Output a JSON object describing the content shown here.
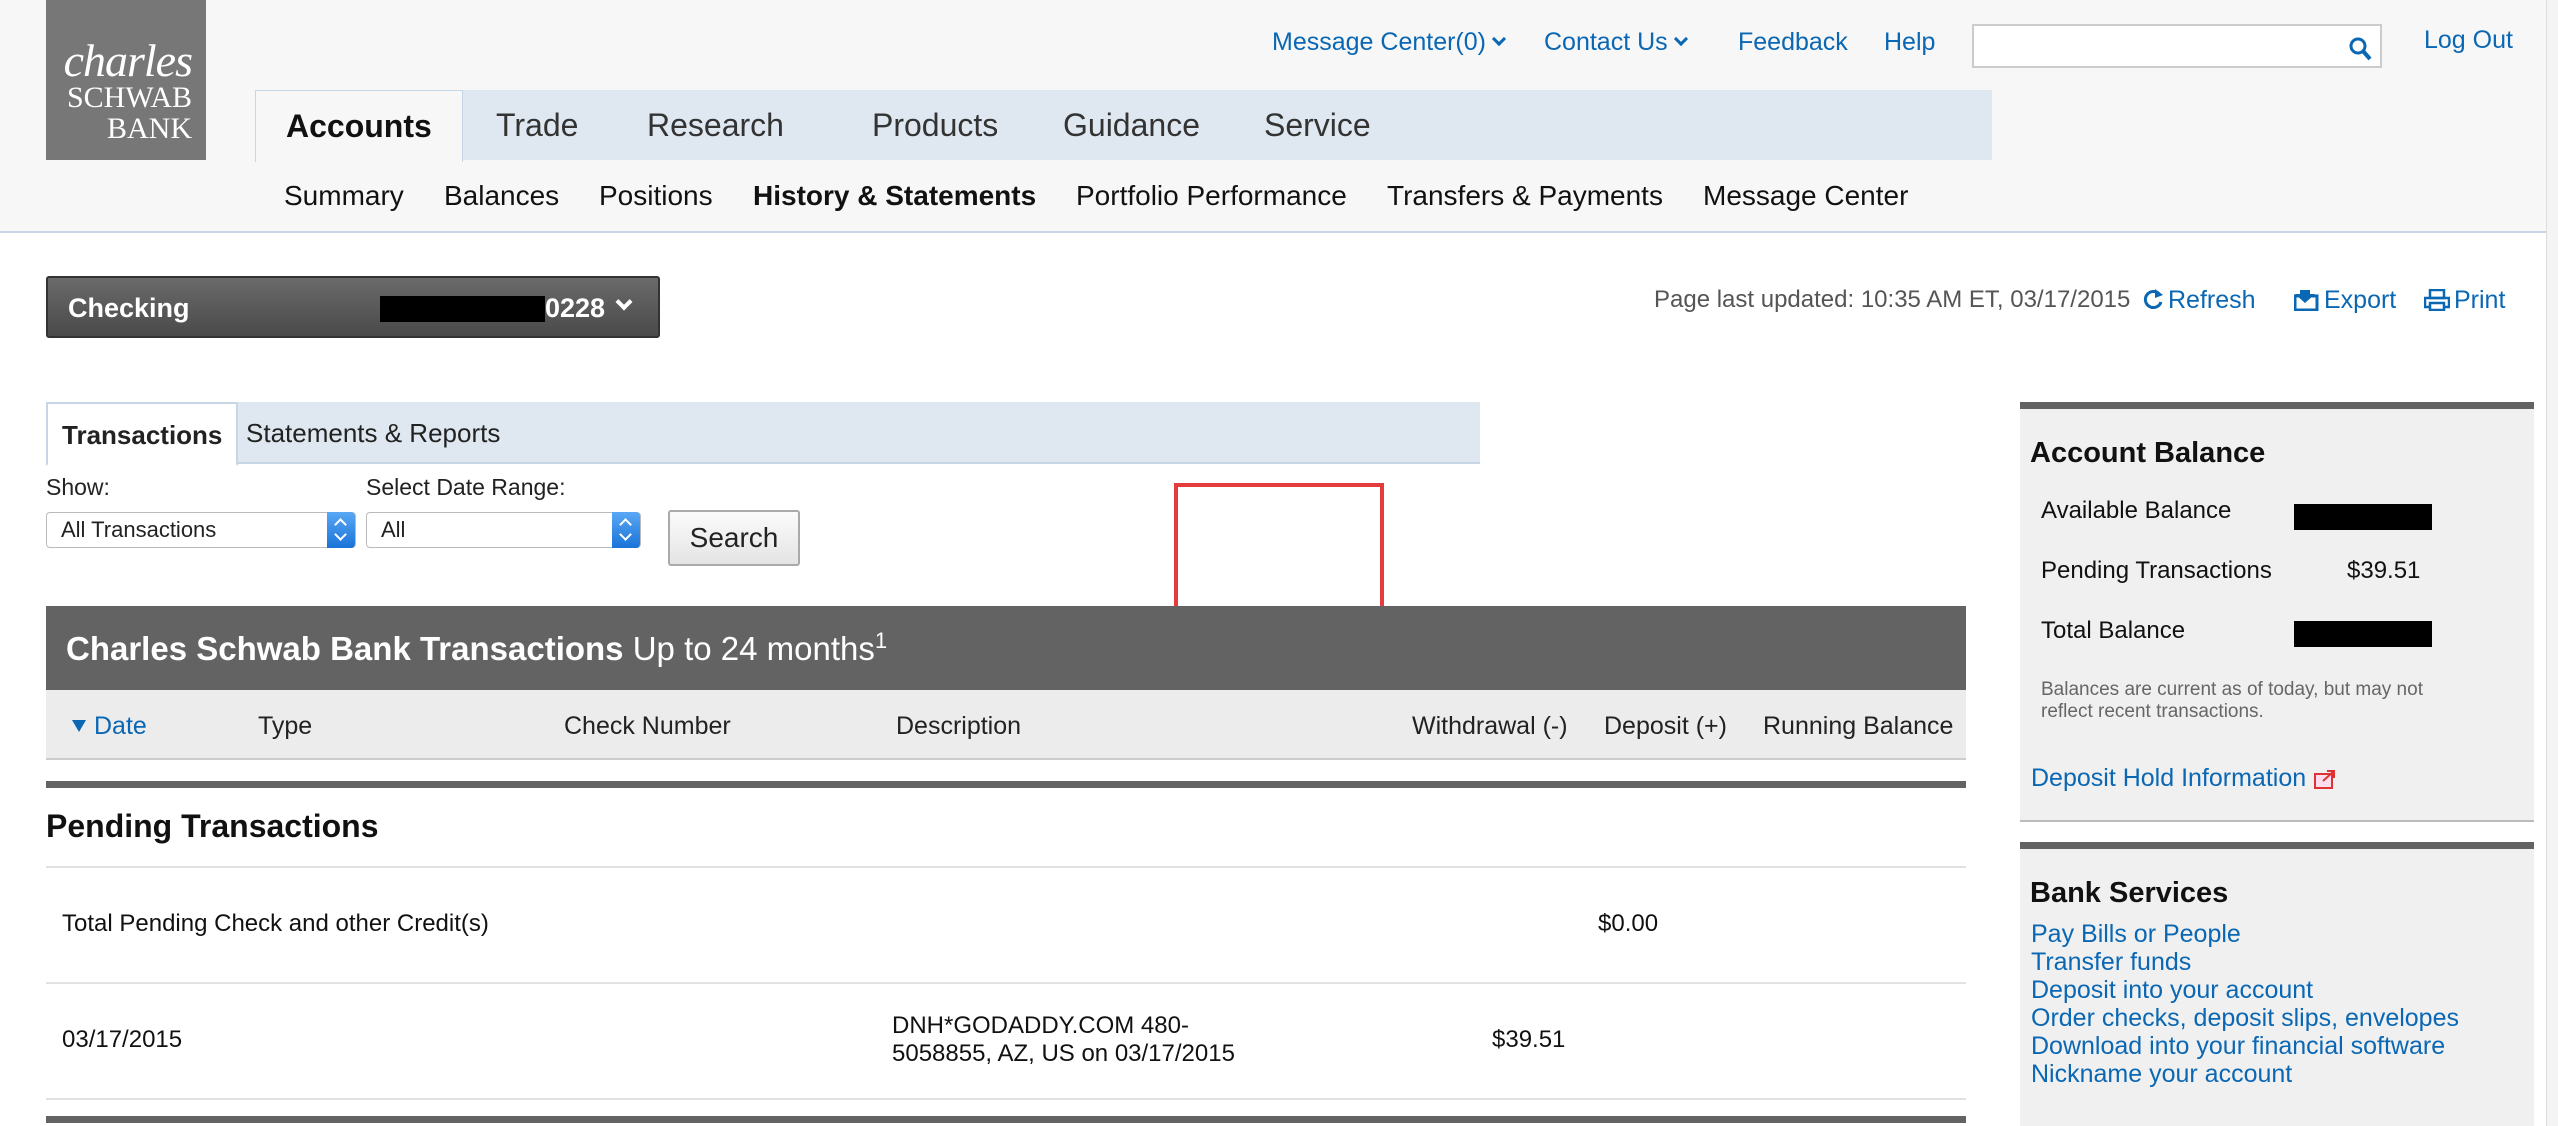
{
  "logo": {
    "line1": "charles",
    "line2": "SCHWAB",
    "line3": "BANK"
  },
  "utility_nav": {
    "message_center": "Message Center(0)",
    "contact_us": "Contact Us",
    "feedback": "Feedback",
    "help": "Help",
    "search_value": "",
    "logout": "Log Out"
  },
  "primary_nav": [
    "Accounts",
    "Trade",
    "Research",
    "Products",
    "Guidance",
    "Service"
  ],
  "sub_nav": [
    "Summary",
    "Balances",
    "Positions",
    "History & Statements",
    "Portfolio Performance",
    "Transfers & Payments",
    "Message Center"
  ],
  "account": {
    "type": "Checking",
    "number_suffix": "0228"
  },
  "page_updated": "Page last updated: 10:35 AM ET, 03/17/2015",
  "actions": {
    "refresh": "Refresh",
    "export": "Export",
    "print": "Print"
  },
  "tabs": [
    "Transactions",
    "Statements & Reports"
  ],
  "filters": {
    "show_label": "Show:",
    "show_value": "All Transactions",
    "date_label": "Select Date Range:",
    "date_value": "All",
    "search_button": "Search"
  },
  "transactions": {
    "title_bold": "Charles Schwab Bank Transactions",
    "title_rest": "Up to 24 months",
    "footnote": "1",
    "columns": [
      "Date",
      "Type",
      "Check Number",
      "Description",
      "Withdrawal (-)",
      "Deposit (+)",
      "Running Balance"
    ],
    "pending_title": "Pending Transactions",
    "pending_total_label": "Total Pending Check and other Credit(s)",
    "pending_total_amount": "$0.00",
    "rows": [
      {
        "date": "03/17/2015",
        "desc_line1": "DNH*GODADDY.COM 480-",
        "desc_line2": "5058855, AZ, US on 03/17/2015",
        "withdrawal": "$39.51"
      }
    ]
  },
  "account_balance": {
    "title": "Account Balance",
    "available_label": "Available Balance",
    "pending_label": "Pending Transactions",
    "pending_value": "$39.51",
    "total_label": "Total Balance",
    "note": "Balances are current as of today, but may not reflect recent transactions.",
    "hold_link": "Deposit Hold Information"
  },
  "bank_services": {
    "title": "Bank Services",
    "links": [
      "Pay Bills or People",
      "Transfer funds",
      "Deposit into your account",
      "Order checks, deposit slips, envelopes",
      "Download into your financial software",
      "Nickname your account"
    ]
  },
  "colors": {
    "link": "#0a67b3",
    "header_gray": "#636363",
    "nav_blue": "#dfe8f0",
    "highlight_red": "#e23c3c"
  }
}
